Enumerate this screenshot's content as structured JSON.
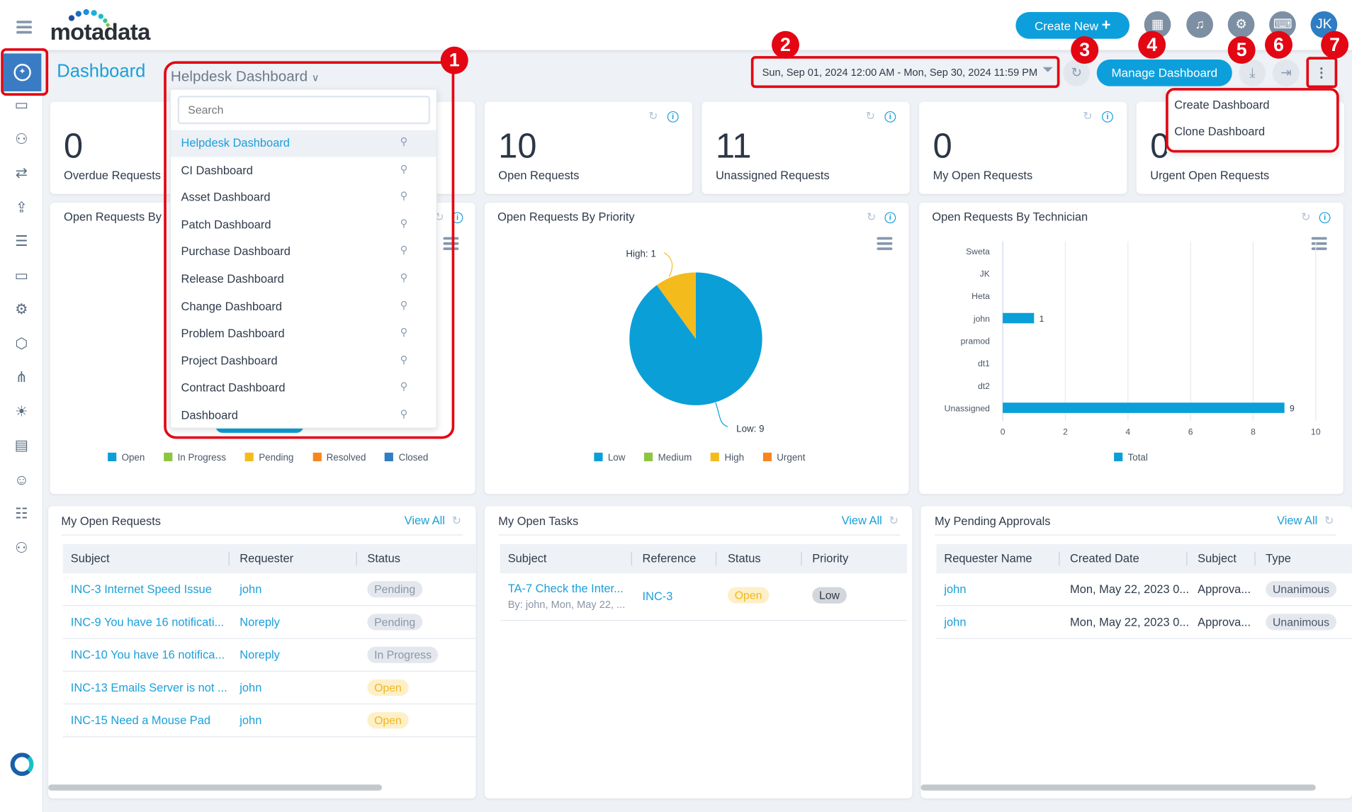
{
  "header": {
    "logo": "motadata",
    "create_new": "Create New",
    "create_icon": "+",
    "avatar": "JK",
    "icons": [
      "calendar-icon",
      "bell-icon",
      "gear-icon",
      "keyboard-icon"
    ]
  },
  "sidebar": {
    "items": [
      "dashboard",
      "ticket",
      "users",
      "transfer",
      "upload",
      "database",
      "laptop",
      "cog",
      "package",
      "hierarchy",
      "lightbulb",
      "report",
      "person",
      "checklist",
      "team"
    ]
  },
  "titlebar": {
    "title": "Dashboard",
    "selected_dashboard": "Helpdesk Dashboard",
    "date_range": "Sun, Sep 01, 2024 12:00 AM - Mon, Sep 30, 2024 11:59 PM",
    "manage": "Manage Dashboard"
  },
  "annotations": [
    "1",
    "2",
    "3",
    "4",
    "5",
    "6",
    "7"
  ],
  "dashboard_dropdown": {
    "search_placeholder": "Search",
    "items": [
      "Helpdesk Dashboard",
      "CI Dashboard",
      "Asset Dashboard",
      "Patch Dashboard",
      "Purchase Dashboard",
      "Release Dashboard",
      "Change Dashboard",
      "Problem Dashboard",
      "Project Dashboard",
      "Contract Dashboard",
      "Dashboard"
    ]
  },
  "more_menu": {
    "items": [
      "Create Dashboard",
      "Clone Dashboard"
    ]
  },
  "kpis": [
    {
      "value": "0",
      "label": "Overdue Requests"
    },
    {
      "value": "10",
      "label": "Open Requests"
    },
    {
      "value": "11",
      "label": "Unassigned Requests"
    },
    {
      "value": "0",
      "label": "My Open Requests"
    },
    {
      "value": "0",
      "label": "Urgent Open Requests"
    }
  ],
  "widgets": {
    "status_title": "Open Requests By",
    "priority_title": "Open Requests By Priority",
    "technician_title": "Open Requests By Technician"
  },
  "chart_data": [
    {
      "type": "bar",
      "title": "Open Requests By",
      "legend": [
        "Open",
        "In Progress",
        "Pending",
        "Resolved",
        "Closed"
      ],
      "colors": [
        "#0b9fd8",
        "#8cc63f",
        "#f4bb1c",
        "#f7861f",
        "#2f7dc2"
      ],
      "legend_position": "bottom"
    },
    {
      "type": "pie",
      "title": "Open Requests By Priority",
      "slices": [
        {
          "label": "Low",
          "value": 9,
          "color": "#0b9fd8"
        },
        {
          "label": "High",
          "value": 1,
          "color": "#f4bb1c"
        }
      ],
      "data_labels": [
        "High: 1",
        "Low: 9"
      ],
      "legend": [
        {
          "label": "Low",
          "color": "#0b9fd8"
        },
        {
          "label": "Medium",
          "color": "#8cc63f"
        },
        {
          "label": "High",
          "color": "#f4bb1c"
        },
        {
          "label": "Urgent",
          "color": "#f7861f"
        }
      ],
      "legend_position": "bottom"
    },
    {
      "type": "bar",
      "orientation": "horizontal",
      "title": "Open Requests By Technician",
      "categories": [
        "Sweta",
        "JK",
        "Heta",
        "john",
        "pramod",
        "dt1",
        "dt2",
        "Unassigned"
      ],
      "series": [
        {
          "name": "Total",
          "values": [
            0,
            0,
            0,
            1,
            0,
            0,
            0,
            9
          ],
          "color": "#0b9fd8"
        }
      ],
      "xlim": [
        0,
        10
      ],
      "xticks": [
        "0",
        "2",
        "4",
        "6",
        "8",
        "10"
      ],
      "grid": true,
      "legend_position": "bottom"
    }
  ],
  "my_open_requests": {
    "title": "My Open Requests",
    "view_all": "View All",
    "columns": [
      "Subject",
      "Requester",
      "Status"
    ],
    "rows": [
      [
        "INC-3 Internet Speed Issue",
        "john",
        "Pending"
      ],
      [
        "INC-9 You have 16 notificati...",
        "Noreply",
        "Pending"
      ],
      [
        "INC-10 You have 16 notifica...",
        "Noreply",
        "In Progress"
      ],
      [
        "INC-13 Emails Server is not ...",
        "john",
        "Open"
      ],
      [
        "INC-15 Need a Mouse Pad",
        "john",
        "Open"
      ]
    ]
  },
  "my_open_tasks": {
    "title": "My Open Tasks",
    "view_all": "View All",
    "columns": [
      "Subject",
      "Reference",
      "Status",
      "Priority"
    ],
    "rows": [
      {
        "subject": "TA-7 Check the Inter...",
        "sub": "By: john, Mon, May 22, ...",
        "reference": "INC-3",
        "status": "Open",
        "priority": "Low"
      }
    ]
  },
  "my_pending_approvals": {
    "title": "My Pending Approvals",
    "view_all": "View All",
    "columns": [
      "Requester Name",
      "Created Date",
      "Subject",
      "Type"
    ],
    "rows": [
      [
        "john",
        "Mon, May 22, 2023 0...",
        "Approva...",
        "Unanimous"
      ],
      [
        "john",
        "Mon, May 22, 2023 0...",
        "Approva...",
        "Unanimous"
      ]
    ]
  }
}
